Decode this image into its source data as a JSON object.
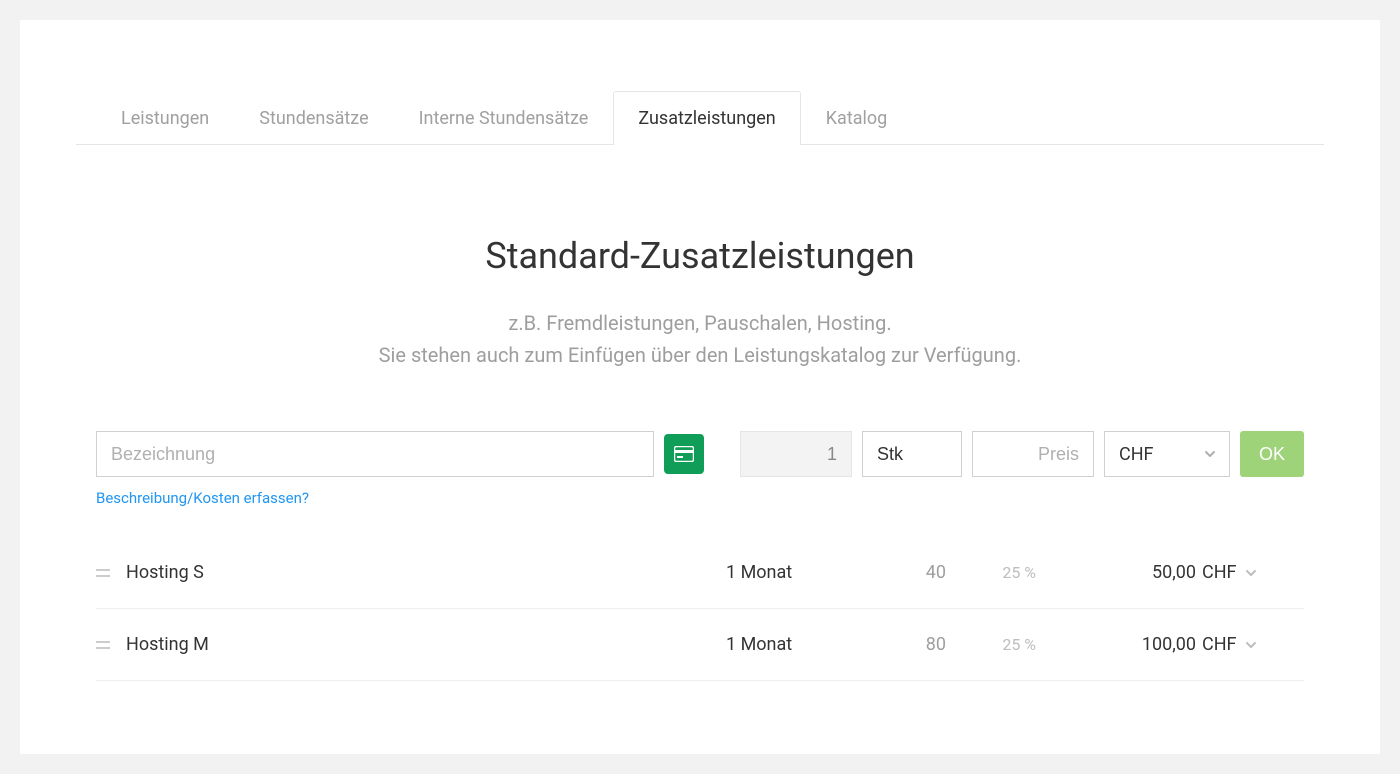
{
  "tabs": [
    {
      "label": "Leistungen"
    },
    {
      "label": "Stundensätze"
    },
    {
      "label": "Interne Stundensätze"
    },
    {
      "label": "Zusatzleistungen"
    },
    {
      "label": "Katalog"
    }
  ],
  "active_tab_index": 3,
  "hero": {
    "title": "Standard-Zusatzleistungen",
    "line1": "z.B. Fremdleistungen, Pauschalen, Hosting.",
    "line2": "Sie stehen auch zum Einfügen über den Leistungskatalog zur Verfügung."
  },
  "form": {
    "name_placeholder": "Bezeichnung",
    "qty_value": "1",
    "unit_value": "Stk",
    "price_placeholder": "Preis",
    "currency_value": "CHF",
    "ok_label": "OK",
    "desc_link": "Beschreibung/Kosten erfassen?"
  },
  "items": [
    {
      "name": "Hosting S",
      "qty": "1 Monat",
      "cost": "40",
      "pct": "25 %",
      "price": "50,00",
      "currency": "CHF"
    },
    {
      "name": "Hosting M",
      "qty": "1 Monat",
      "cost": "80",
      "pct": "25 %",
      "price": "100,00",
      "currency": "CHF"
    }
  ]
}
